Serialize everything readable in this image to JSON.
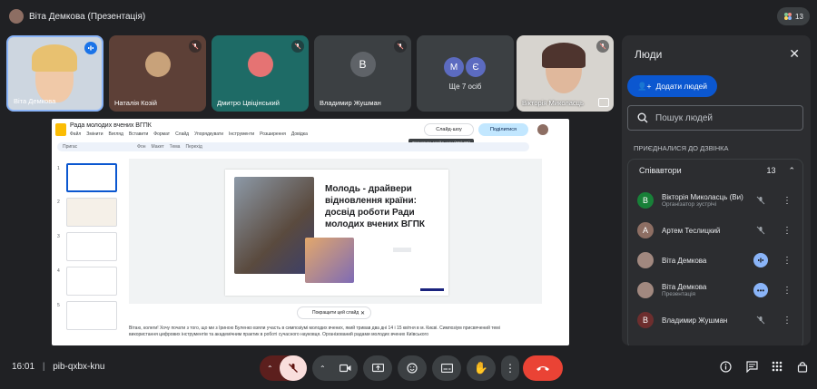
{
  "top": {
    "presenter_label": "Віта Демкова (Презентація)",
    "participant_count": "13"
  },
  "tiles": [
    {
      "name": "Віта Демкова"
    },
    {
      "name": "Наталія Козій"
    },
    {
      "name": "Дмитро Цвіцінський"
    },
    {
      "name": "Владимир Жушман",
      "initial": "В"
    },
    {
      "name": "Ще 7 осіб",
      "initials": [
        "М",
        "Є"
      ]
    },
    {
      "name": "Вікторія Миколасць"
    }
  ],
  "presentation": {
    "doc_title": "Рада молодих вчених ВГПК",
    "menu": [
      "Файл",
      "Змінити",
      "Вигляд",
      "Вставити",
      "Формат",
      "Слайд",
      "Упорядкувати",
      "Інструменти",
      "Розширення",
      "Довідка"
    ],
    "slideshow_label": "Слайд-шоу",
    "share_label": "Поділитися",
    "tooltip": "Запустити слайд-шоу (Ctrl+F5)",
    "toolbar": [
      "Пригас",
      "Фон",
      "Макет",
      "Тема",
      "Перехід"
    ],
    "slide_numbers": [
      "1",
      "2",
      "3",
      "4",
      "5"
    ],
    "slide_title": "Молодь - драйвери відновлення країни: досвід роботи Ради молодих вчених ВГПК",
    "improve_label": "Покращити цей слайд",
    "notes": "Вітаю, колеги! Хочу почати з того, що ми з Іриною Буленко взяли участь в симпозіумі молодих вчених, який тривав два дні 14 і 15 квітня в м. Києві. Симпозіум присвячений темі використання цифрових інструментів та академічним практик в роботі сучасного науковця. Організований радами молодих вчених Київського"
  },
  "side_panel": {
    "title": "Люди",
    "add_label": "Додати людей",
    "search_placeholder": "Пошук людей",
    "joined_label": "ПРИЄДНАЛИСЯ ДО ДЗВІНКА",
    "group_label": "Співавтори",
    "group_count": "13",
    "people": [
      {
        "initial": "В",
        "name": "Вікторія Миколасць (Ви)",
        "role": "Організатор зустрічі",
        "color": "#188038",
        "status": "muted"
      },
      {
        "initial": "А",
        "name": "Артем Теслицкий",
        "role": "",
        "color": "#8d6e63",
        "status": "muted"
      },
      {
        "initial": "",
        "name": "Віта Демкова",
        "role": "",
        "color": "#a1887f",
        "status": "speaking"
      },
      {
        "initial": "",
        "name": "Віта Демкова",
        "role": "Презентація",
        "color": "#a1887f",
        "status": "more"
      },
      {
        "initial": "В",
        "name": "Владимир Жушман",
        "role": "",
        "color": "#6d2e2e",
        "status": "muted"
      }
    ]
  },
  "bottom": {
    "time": "16:01",
    "meeting_code": "pib-qxbx-knu"
  },
  "colors": {
    "accent": "#0b57d0",
    "end_call": "#ea4335",
    "speaking": "#1a73e8"
  }
}
